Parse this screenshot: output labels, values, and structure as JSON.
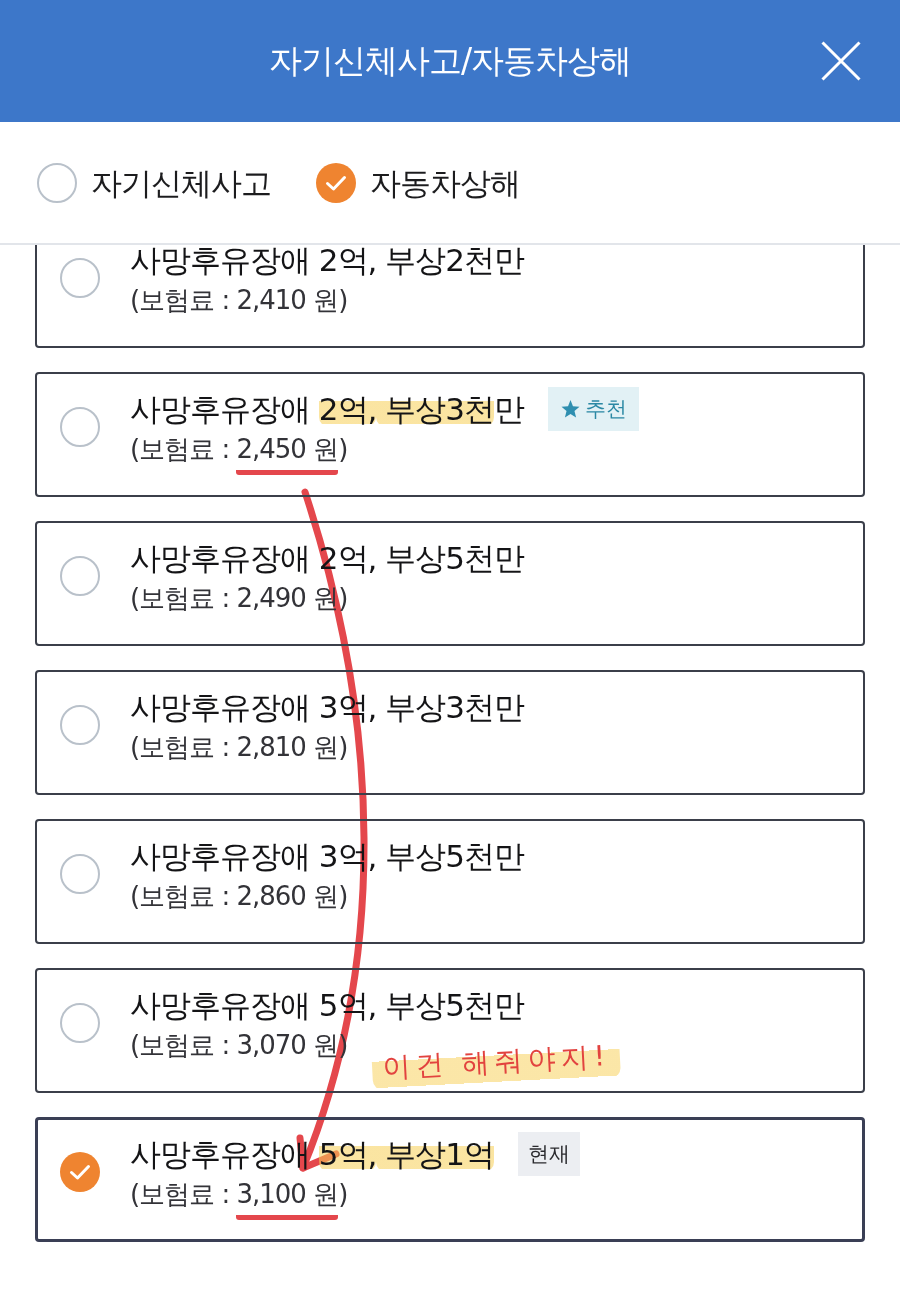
{
  "header": {
    "title": "자기신체사고/자동차상해"
  },
  "coverage_types": [
    {
      "label": "자기신체사고",
      "selected": false
    },
    {
      "label": "자동차상해",
      "selected": true
    }
  ],
  "options": [
    {
      "title": [
        {
          "text": "사망후유장애 2억, 부상2천만",
          "highlighted": false
        }
      ],
      "premium": {
        "text_before": "(보험료 : ",
        "amount": "2,410 원",
        "text_after": ")",
        "underlined": false
      },
      "selected": false
    },
    {
      "title": [
        {
          "text": "사망후유장애 ",
          "highlighted": false
        },
        {
          "text": "2억,",
          "highlighted": true
        },
        {
          "text": " 부상3천",
          "highlighted": true
        },
        {
          "text": "만",
          "highlighted": false
        }
      ],
      "premium": {
        "text_before": "(보험료 : ",
        "amount": "2,450 원",
        "text_after": ")",
        "underlined": true
      },
      "badge": {
        "kind": "recommended",
        "label": "추천"
      },
      "selected": false
    },
    {
      "title": [
        {
          "text": "사망후유장애 2억, 부상5천만",
          "highlighted": false
        }
      ],
      "premium": {
        "text_before": "(보험료 : ",
        "amount": "2,490 원",
        "text_after": ")",
        "underlined": false
      },
      "selected": false
    },
    {
      "title": [
        {
          "text": "사망후유장애 3억, 부상3천만",
          "highlighted": false
        }
      ],
      "premium": {
        "text_before": "(보험료 : ",
        "amount": "2,810 원",
        "text_after": ")",
        "underlined": false
      },
      "selected": false
    },
    {
      "title": [
        {
          "text": "사망후유장애 3억, 부상5천만",
          "highlighted": false
        }
      ],
      "premium": {
        "text_before": "(보험료 : ",
        "amount": "2,860 원",
        "text_after": ")",
        "underlined": false
      },
      "selected": false
    },
    {
      "title": [
        {
          "text": "사망후유장애 5억, 부상5천만",
          "highlighted": false
        }
      ],
      "premium": {
        "text_before": "(보험료 : ",
        "amount": "3,070 원",
        "text_after": ")",
        "underlined": false
      },
      "selected": false
    },
    {
      "title": [
        {
          "text": "사망후유장애 ",
          "highlighted": false
        },
        {
          "text": "5억,",
          "highlighted": true
        },
        {
          "text": " 부상1억",
          "highlighted": true
        }
      ],
      "premium": {
        "text_before": "(보험료 : ",
        "amount": "3,100 원",
        "text_after": ")",
        "underlined": true
      },
      "badge": {
        "kind": "current",
        "label": "현재"
      },
      "selected": true
    }
  ],
  "annotations": {
    "note": "이건 해줘야지!"
  }
}
